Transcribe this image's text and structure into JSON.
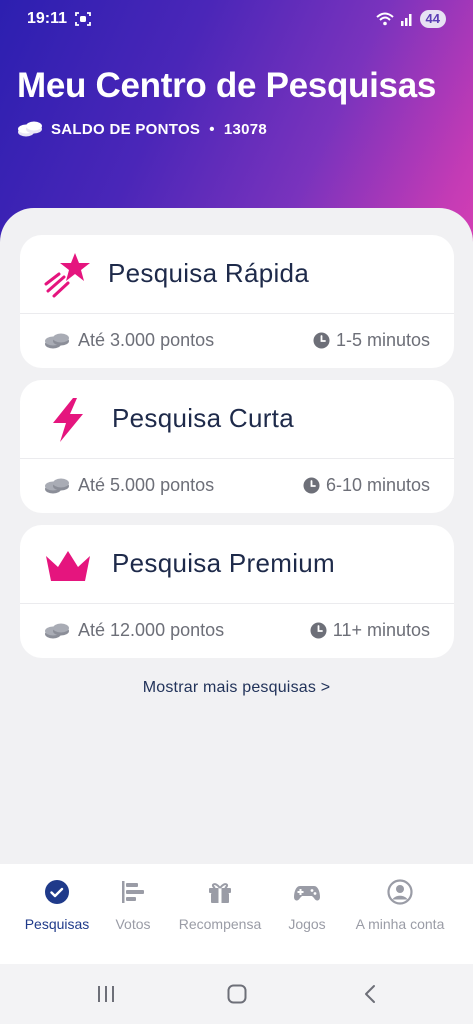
{
  "status": {
    "time": "19:11",
    "battery": "44"
  },
  "header": {
    "title": "Meu Centro de Pesquisas",
    "balance_label": "SALDO DE PONTOS",
    "separator": "•",
    "balance_value": "13078"
  },
  "surveys": [
    {
      "name": "Pesquisa Rápida",
      "points": "Até 3.000 pontos",
      "duration": "1-5 minutos",
      "icon": "shooting-star-icon",
      "color": "#e5157e"
    },
    {
      "name": "Pesquisa Curta",
      "points": "Até 5.000 pontos",
      "duration": "6-10 minutos",
      "icon": "lightning-icon",
      "color": "#e5157e"
    },
    {
      "name": "Pesquisa Premium",
      "points": "Até 12.000 pontos",
      "duration": "11+ minutos",
      "icon": "crown-icon",
      "color": "#e5157e"
    }
  ],
  "more_link": "Mostrar mais pesquisas  >",
  "nav": [
    {
      "label": "Pesquisas",
      "icon": "check-circle-icon",
      "active": true
    },
    {
      "label": "Votos",
      "icon": "bar-list-icon",
      "active": false
    },
    {
      "label": "Recompensa",
      "icon": "gift-icon",
      "active": false
    },
    {
      "label": "Jogos",
      "icon": "gamepad-icon",
      "active": false
    },
    {
      "label": "A minha conta",
      "icon": "user-circle-icon",
      "active": false
    }
  ],
  "colors": {
    "accent": "#1f3a8a",
    "brand_pink": "#e5157e",
    "gradient_start": "#2c1fb0",
    "gradient_end": "#d83fb4"
  }
}
